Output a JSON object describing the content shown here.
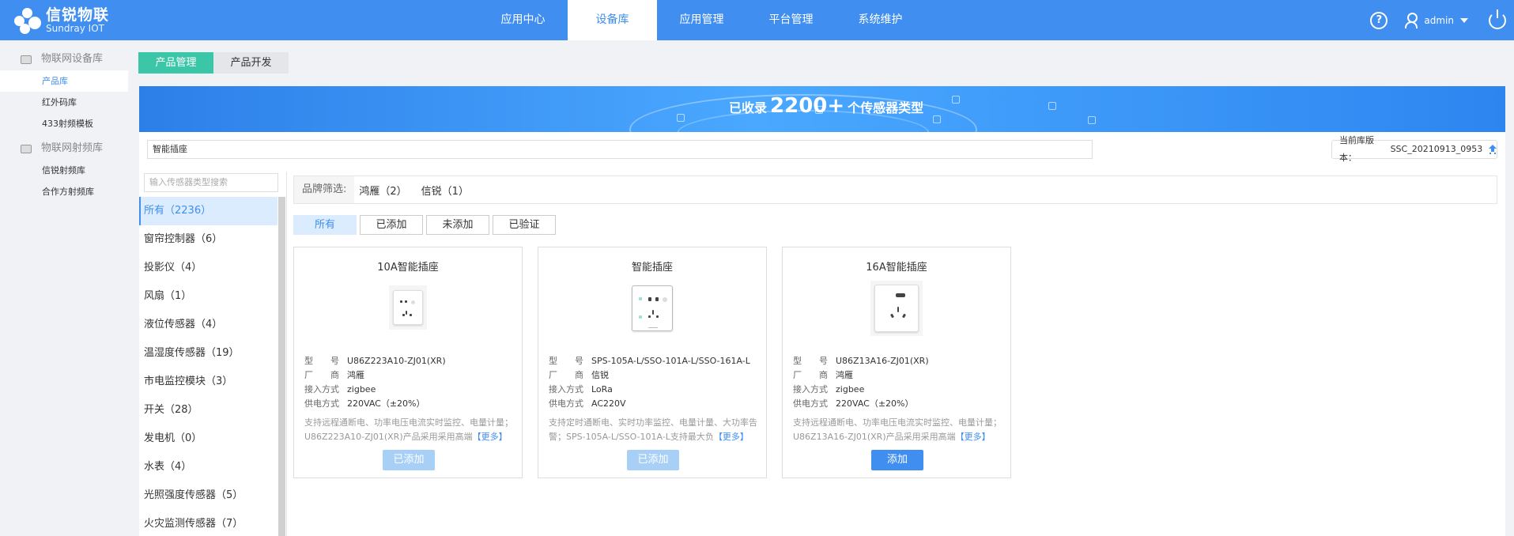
{
  "header": {
    "logo_title": "信锐物联",
    "logo_subtitle": "Sundray IOT",
    "nav": [
      "应用中心",
      "设备库",
      "应用管理",
      "平台管理",
      "系统维护"
    ],
    "active_nav": "设备库",
    "help": "?",
    "username": "admin"
  },
  "sidebar": {
    "groups": [
      {
        "label": "物联网设备库",
        "items": [
          "产品库",
          "红外码库",
          "433射频模板"
        ]
      },
      {
        "label": "物联网射频库",
        "items": [
          "信锐射频库",
          "合作方射频库"
        ]
      }
    ],
    "active_item": "产品库"
  },
  "tabs": [
    "产品管理",
    "产品开发"
  ],
  "banner": {
    "prefix": "已收录",
    "number": "2200+",
    "suffix": "个传感器类型"
  },
  "search_value": "智能插座",
  "version_label": "当前库版本：",
  "version_value": "SSC_20210913_0953",
  "category_search_placeholder": "输入传感器类型搜索",
  "categories": [
    "所有（2236）",
    "窗帘控制器（6）",
    "投影仪（4）",
    "风扇（1）",
    "液位传感器（4）",
    "温湿度传感器（19）",
    "市电监控模块（3）",
    "开关（28）",
    "发电机（0）",
    "水表（4）",
    "光照强度传感器（5）",
    "火灾监测传感器（7）"
  ],
  "brand_filter": {
    "label": "品牌筛选:",
    "brands": [
      "鸿雁（2）",
      "信锐（1）"
    ]
  },
  "status_filters": [
    "所有",
    "已添加",
    "未添加",
    "已验证"
  ],
  "spec_keys": [
    "型　　号",
    "厂　　商",
    "接入方式",
    "供电方式"
  ],
  "more_label": "【更多】",
  "products": [
    {
      "title": "10A智能插座",
      "model": "U86Z223A10-ZJ01(XR)",
      "vendor": "鸿雁",
      "access": "zigbee",
      "power": "220VAC（±20%）",
      "desc": "支持远程通断电、功率电压电流实时监控、电量计量；U86Z223A10-ZJ01(XR)产品采用采用高端",
      "button": "已添加",
      "button_state": "disabled"
    },
    {
      "title": "智能插座",
      "model": "SPS-105A-L/SSO-101A-L/SSO-161A-L",
      "vendor": "信锐",
      "access": "LoRa",
      "power": "AC220V",
      "desc": "支持定时通断电、实时功率监控、电量计量、大功率告警；SPS-105A-L/SSO-101A-L支持最大负",
      "button": "已添加",
      "button_state": "disabled"
    },
    {
      "title": "16A智能插座",
      "model": "U86Z13A16-ZJ01(XR)",
      "vendor": "鸿雁",
      "access": "zigbee",
      "power": "220VAC（±20%）",
      "desc": "支持远程通断电、功率电压电流实时监控、电量计量；U86Z13A16-ZJ01(XR)产品采用采用高端",
      "button": "添加",
      "button_state": "primary"
    }
  ]
}
